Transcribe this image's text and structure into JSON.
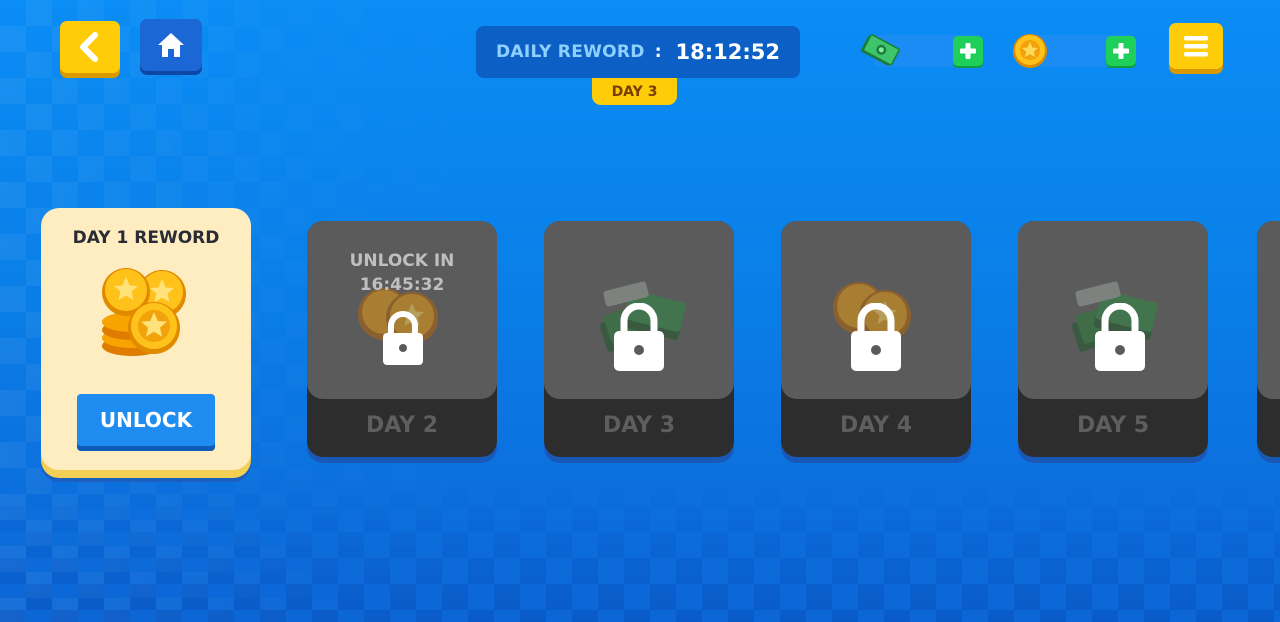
{
  "header": {
    "daily_label": "DAILY REWORD",
    "separator": ":",
    "timer": "18:12:52",
    "current_day_tab": "DAY 3"
  },
  "currencies": {
    "cash": {
      "icon": "cash-icon",
      "value": ""
    },
    "coins": {
      "icon": "coin-icon",
      "value": ""
    }
  },
  "buttons": {
    "back": {
      "icon": "chevron-left-icon"
    },
    "home": {
      "icon": "home-icon"
    },
    "menu": {
      "icon": "menu-icon"
    }
  },
  "rewards": [
    {
      "title": "DAY 1 REWORD",
      "reward": "coins",
      "button_label": "UNLOCK",
      "locked": false
    },
    {
      "day_label": "DAY 2",
      "reward": "coins",
      "unlock_text_line1": "UNLOCK IN",
      "unlock_text_line2": "16:45:32",
      "locked": true
    },
    {
      "day_label": "DAY 3",
      "reward": "cash",
      "locked": true
    },
    {
      "day_label": "DAY 4",
      "reward": "coins",
      "locked": true
    },
    {
      "day_label": "DAY 5",
      "reward": "cash",
      "locked": true
    }
  ],
  "colors": {
    "accent_yellow": "#ffcc0a",
    "button_blue": "#1e8cf0",
    "plus_green": "#1ed05a",
    "locked_gray": "#5b5b5b",
    "card_cream": "#fdedc0"
  }
}
